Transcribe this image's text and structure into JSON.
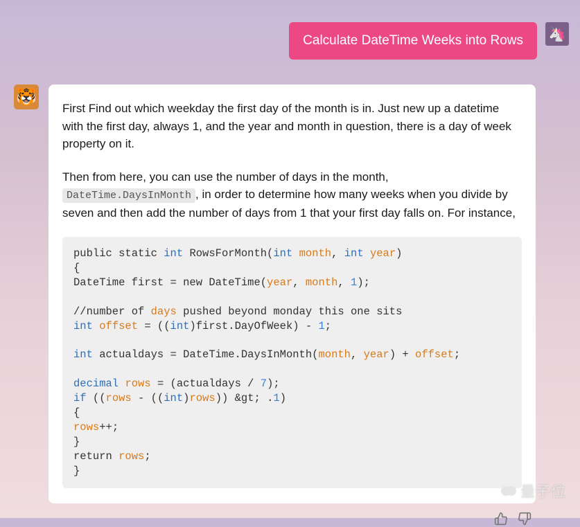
{
  "user": {
    "message": "Calculate DateTime Weeks into Rows",
    "avatarEmoji": "🦄"
  },
  "assistant": {
    "avatarEmoji": "🐯",
    "para1": "First Find out which weekday the first day of the month is in. Just new up a datetime with the first day, always 1, and the year and month in question, there is a day of week property on it.",
    "para2_pre": "Then from here, you can use the number of days in the month, ",
    "para2_code": "DateTime.DaysInMonth",
    "para2_post": ", in order to determine how many weeks when you divide by seven and then add the number of days from 1 that your first day falls on. For instance,",
    "code": {
      "l1_a": "public static ",
      "l1_int": "int",
      "l1_b": " RowsForMonth(",
      "l1_int2": "int",
      "l1_sp": " ",
      "l1_month": "month",
      "l1_c": ", ",
      "l1_int3": "int",
      "l1_year": "year",
      "l1_d": ")",
      "l2": "{",
      "l3_a": "DateTime first = new DateTime(",
      "l3_year": "year",
      "l3_b": ", ",
      "l3_month": "month",
      "l3_c": ", ",
      "l3_1": "1",
      "l3_d": ");",
      "l5_a": "//number of ",
      "l5_days": "days",
      "l5_b": " pushed beyond monday this one sits",
      "l6_int": "int",
      "l6_sp": " ",
      "l6_offset": "offset",
      "l6_a": " = ((",
      "l6_int2": "int",
      "l6_b": ")first.DayOfWeek) - ",
      "l6_1": "1",
      "l6_c": ";",
      "l8_int": "int",
      "l8_a": " actualdays = DateTime.DaysInMonth(",
      "l8_month": "month",
      "l8_b": ", ",
      "l8_year": "year",
      "l8_c": ") + ",
      "l8_offset": "offset",
      "l8_d": ";",
      "l10_decimal": "decimal",
      "l10_sp": " ",
      "l10_rows": "rows",
      "l10_a": " = (actualdays / ",
      "l10_7": "7",
      "l10_b": ");",
      "l11_if": "if",
      "l11_a": " ((",
      "l11_rows": "rows",
      "l11_b": " - ((",
      "l11_int": "int",
      "l11_c": ")",
      "l11_rows2": "rows",
      "l11_d": ")) &gt; .",
      "l11_1": "1",
      "l11_e": ")",
      "l12": "{",
      "l13_rows": "rows",
      "l13_a": "++;",
      "l14": "}",
      "l15_a": "return ",
      "l15_rows": "rows",
      "l15_b": ";",
      "l16": "}"
    }
  },
  "watermark": {
    "text": "量子位"
  }
}
